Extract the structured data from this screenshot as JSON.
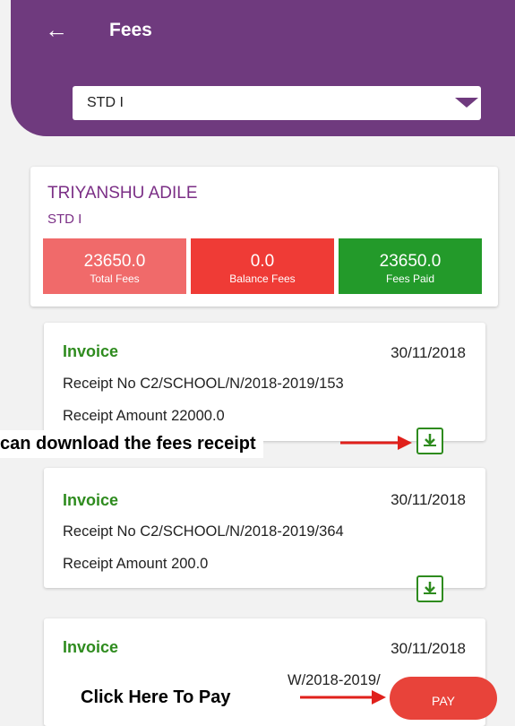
{
  "header": {
    "back_icon": "arrow-left-icon",
    "title": "Fees"
  },
  "class_select": {
    "value": "STD I"
  },
  "student": {
    "name": "TRIYANSHU ADILE",
    "standard": "STD I",
    "stats": [
      {
        "value": "23650.0",
        "label": "Total Fees",
        "color": "#f06a6a"
      },
      {
        "value": "0.0",
        "label": "Balance Fees",
        "color": "#ef3b36"
      },
      {
        "value": "23650.0",
        "label": "Fees Paid",
        "color": "#239a2a"
      }
    ]
  },
  "invoices": [
    {
      "title": "Invoice",
      "date": "30/11/2018",
      "receipt_no": "Receipt No  C2/SCHOOL/N/2018-2019/153",
      "receipt_amount": "Receipt Amount  22000.0"
    },
    {
      "title": "Invoice",
      "date": "30/11/2018",
      "receipt_no": "Receipt No  C2/SCHOOL/N/2018-2019/364",
      "receipt_amount": "Receipt Amount  200.0"
    },
    {
      "title": "Invoice",
      "date": "30/11/2018",
      "receipt_no_partial": "W/2018-2019/"
    }
  ],
  "annotations": {
    "download": "can download the fees receipt",
    "pay": "Click Here To Pay"
  },
  "pay_button": {
    "label": "PAY"
  },
  "colors": {
    "header": "#6f3a7e",
    "invoice_green": "#2e8b1e",
    "annotation_arrow": "#e0201b",
    "pay": "#e8433a"
  }
}
